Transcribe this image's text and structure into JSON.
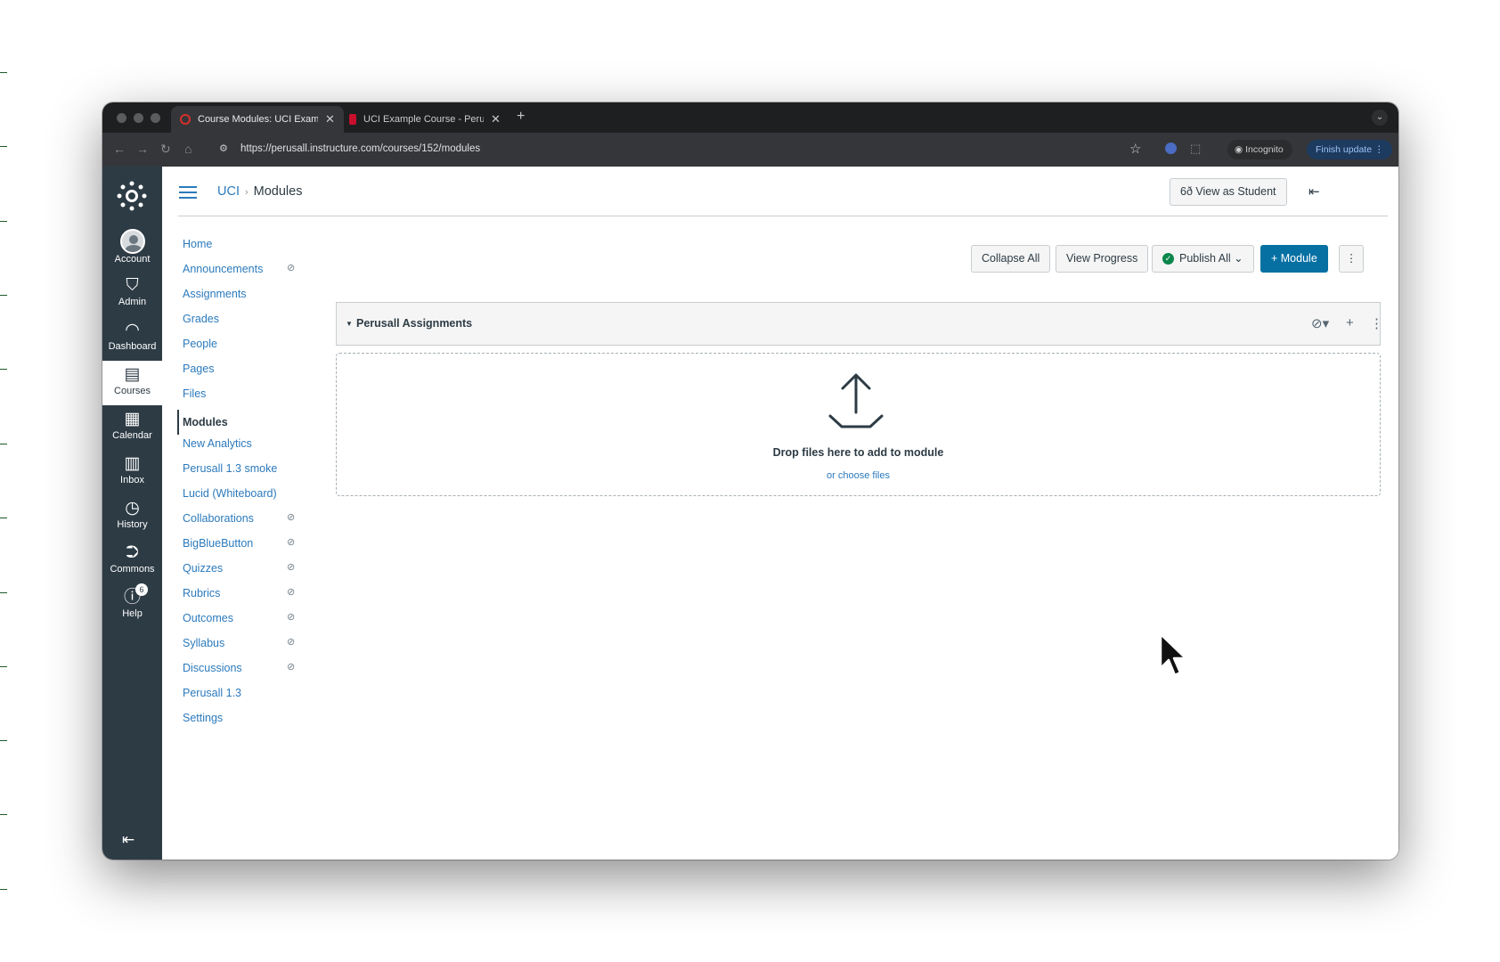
{
  "browser": {
    "tabs": [
      {
        "title": "Course Modules: UCI Example Course",
        "favicon_color": "#d5302a"
      },
      {
        "title": "UCI Example Course - Perusall",
        "favicon_color": "#c8102e"
      }
    ],
    "new_tab_icon": "plus-icon",
    "url": "https://perusall.instructure.com/courses/152/modules",
    "incognito_label": "Incognito",
    "finish_update_label": "Finish update"
  },
  "global_nav": {
    "items": [
      {
        "label": "Account",
        "icon": "avatar-icon"
      },
      {
        "label": "Admin",
        "icon": "shield-icon"
      },
      {
        "label": "Dashboard",
        "icon": "speedometer-icon"
      },
      {
        "label": "Courses",
        "icon": "book-icon"
      },
      {
        "label": "Calendar",
        "icon": "calendar-icon"
      },
      {
        "label": "Inbox",
        "icon": "inbox-icon"
      },
      {
        "label": "History",
        "icon": "clock-icon"
      },
      {
        "label": "Commons",
        "icon": "commons-icon"
      },
      {
        "label": "Help",
        "icon": "help-icon",
        "badge": "6"
      }
    ],
    "active": "Courses",
    "background": "#2d3b45"
  },
  "header": {
    "breadcrumb": {
      "course": "UCI",
      "page": "Modules"
    },
    "view_as_student_label": "View as Student"
  },
  "course_nav": {
    "items": [
      {
        "label": "Home",
        "hidden": false
      },
      {
        "label": "Announcements",
        "hidden": true
      },
      {
        "label": "Assignments",
        "hidden": false
      },
      {
        "label": "Grades",
        "hidden": false
      },
      {
        "label": "People",
        "hidden": false
      },
      {
        "label": "Pages",
        "hidden": false
      },
      {
        "label": "Files",
        "hidden": false
      },
      {
        "label": "Modules",
        "hidden": false
      },
      {
        "label": "New Analytics",
        "hidden": false
      },
      {
        "label": "Perusall 1.3 smoke",
        "hidden": false
      },
      {
        "label": "Lucid (Whiteboard)",
        "hidden": false
      },
      {
        "label": "Collaborations",
        "hidden": true
      },
      {
        "label": "BigBlueButton",
        "hidden": true
      },
      {
        "label": "Quizzes",
        "hidden": true
      },
      {
        "label": "Rubrics",
        "hidden": true
      },
      {
        "label": "Outcomes",
        "hidden": true
      },
      {
        "label": "Syllabus",
        "hidden": true
      },
      {
        "label": "Discussions",
        "hidden": true
      },
      {
        "label": "Perusall 1.3",
        "hidden": false
      },
      {
        "label": "Settings",
        "hidden": false
      }
    ],
    "active": "Modules",
    "link_color": "#2b7abc"
  },
  "modules_toolbar": {
    "collapse_all": "Collapse All",
    "view_progress": "View Progress",
    "publish_all": "Publish All",
    "add_module": "+ Module",
    "accent": "#0770a3",
    "published_color": "#0b874b"
  },
  "module": {
    "title": "Perusall Assignments",
    "dropzone_text": "Drop files here to add to module",
    "dropzone_link": "or choose files"
  }
}
